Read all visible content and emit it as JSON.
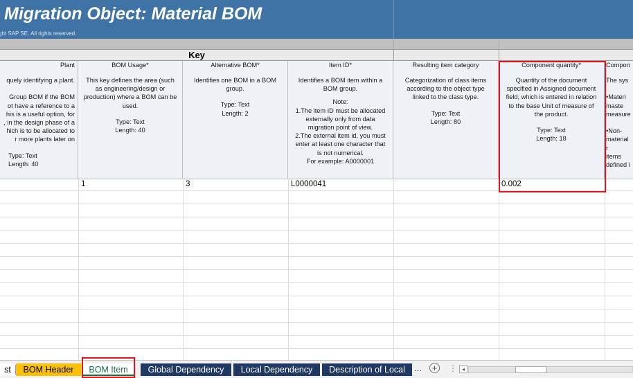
{
  "banner": {
    "title": "Migration Object:  Material BOM",
    "copyright": "ght SAP SE. All rights reserved."
  },
  "key_row": {
    "label": "Key"
  },
  "columns": [
    {
      "header": "Plant",
      "description": "quely identifying a plant.\n\nGroup BOM if the BOM\not have a reference to a\nhis is a useful option, for\n, in the design phase of a\nhich is to be allocated to\nr more plants later on",
      "type": "Type: Text\nLength: 40"
    },
    {
      "header": "BOM Usage*",
      "description": "This key defines the area (such\nas engineering/design or\nproduction) where a BOM can be\nused.",
      "type": "Type: Text\nLength: 40"
    },
    {
      "header": "Alternative BOM*",
      "description": "Identifies one BOM in a BOM\ngroup.",
      "type": "Type: Text\nLength: 2"
    },
    {
      "header": "Item ID*",
      "description": "Identifies a BOM item within a\nBOM group.",
      "type": "Note:\n1.The item ID must be allocated\nexternally only from data\nmigration point of view.\n2.The external item id, you must\nenter at least one character that\nis not numerical.\nFor example: A0000001"
    },
    {
      "header": "Resulting item category",
      "description": "Categorization of class items\naccording to the object type\nlinked to the class type.",
      "type": "Type: Text\nLength: 80"
    },
    {
      "header": "Component quantity*",
      "description": "Quantity of the document\nspecified in Assigned document\nfield, which is entered in relation\nto the base Unit of measure of\nthe product.",
      "type": "Type: Text\nLength: 18"
    },
    {
      "header": "Compon",
      "description": "The sys\n\n•Materi\nmaste\nmeasure\n\n•Non-\nmaterial r\nitems\ndefined i",
      "type": ""
    }
  ],
  "data_row": {
    "plant": "",
    "bom_usage": "1",
    "alternative_bom": "3",
    "item_id": "L0000041",
    "resulting_item_category": "",
    "component_quantity": "0.002",
    "component_unit": ""
  },
  "tabs": [
    {
      "label": "st",
      "style": "plain"
    },
    {
      "label": "BOM Header",
      "style": "yellow"
    },
    {
      "label": "BOM Item",
      "style": "active"
    },
    {
      "label": "Global Dependency",
      "style": "navy"
    },
    {
      "label": "Local Dependency",
      "style": "navy"
    },
    {
      "label": "Description of Local",
      "style": "navy"
    }
  ],
  "tab_controls": {
    "more": "...",
    "add": "+",
    "separator": "⋮",
    "scroll_left": "◂"
  },
  "colors": {
    "banner": "#3f73a6",
    "header_fill": "#eef2f6",
    "highlight": "#e0161d",
    "tab_yellow": "#ffc000",
    "tab_navy": "#1f3864",
    "tab_active_text": "#1e7145"
  }
}
